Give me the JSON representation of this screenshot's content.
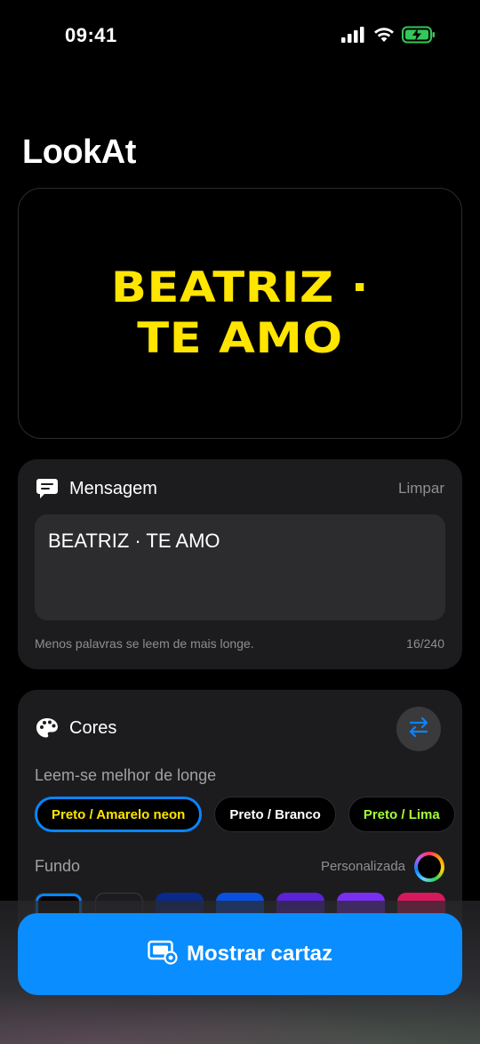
{
  "status_bar": {
    "time": "09:41"
  },
  "app": {
    "title": "LookAt"
  },
  "preview": {
    "text": "BEATRIZ · TE AMO",
    "text_color": "#ffe500",
    "background": "#000000"
  },
  "message_section": {
    "title": "Mensagem",
    "clear_label": "Limpar",
    "input_value": "BEATRIZ · TE AMO",
    "hint": "Menos palavras se leem de mais longe.",
    "counter": "16/240"
  },
  "colors_section": {
    "title": "Cores",
    "subtitle": "Leem-se melhor de longe",
    "presets": [
      {
        "label": "Preto / Amarelo neon",
        "text_color": "#ffe500",
        "selected": true
      },
      {
        "label": "Preto / Branco",
        "text_color": "#ffffff",
        "selected": false
      },
      {
        "label": "Preto / Lima",
        "text_color": "#a4ff3a",
        "selected": false
      }
    ],
    "background_label": "Fundo",
    "custom_label": "Personalizada",
    "swatches": [
      "#000000",
      "#1c1c1e",
      "#0a2a8a",
      "#0a50e0",
      "#5b22d6",
      "#7a2ff0",
      "#d6195a"
    ]
  },
  "primary_button": {
    "label": "Mostrar cartaz",
    "color": "#0a8dff"
  }
}
